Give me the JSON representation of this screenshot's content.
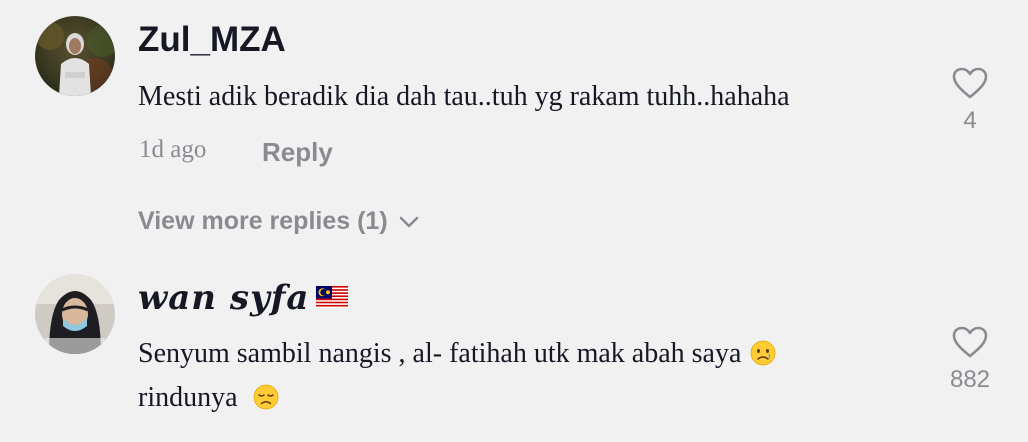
{
  "comments": [
    {
      "username": "Zul_MZA",
      "text": "Mesti adik beradik dia dah tau..tuh yg rakam tuhh..hahaha",
      "time": "1d ago",
      "reply_label": "Reply",
      "likes": "4",
      "view_more": "View more replies (1)"
    },
    {
      "username": "wan syfa",
      "flag": "malaysia-flag-emoji",
      "text_line1": "Senyum sambil nangis , al- fatihah utk mak abah saya",
      "text_line1_emoji": "crying-face-emoji",
      "text_line2": "rindunya",
      "text_line2_emoji": "disappointed-face-emoji",
      "likes": "882"
    }
  ],
  "icons": {
    "like": "heart-outline-icon",
    "expand": "chevron-down-icon"
  },
  "colors": {
    "background": "#f1f1f2",
    "primary_text": "#161823",
    "secondary_text": "#8a8b91"
  }
}
